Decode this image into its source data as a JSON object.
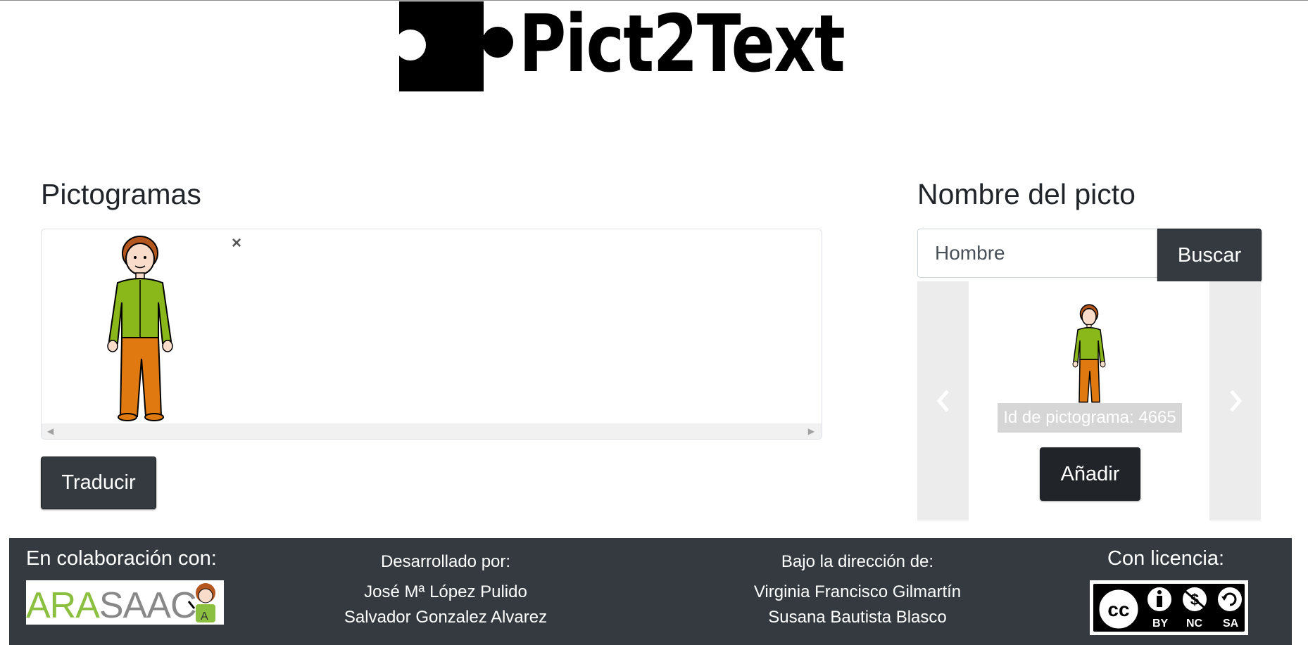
{
  "header": {
    "logo_text": "Pict2Text"
  },
  "pictos": {
    "title": "Pictogramas",
    "remove_label": "×",
    "translate_label": "Traducir"
  },
  "search": {
    "title": "Nombre del picto",
    "value": "Hombre",
    "button_label": "Buscar",
    "result_caption": "Id de pictograma: 4665",
    "add_label": "Añadir"
  },
  "footer": {
    "collab_title": "En colaboración con:",
    "collab_logo_text": "ARASAAC",
    "developed_title": "Desarrollado por:",
    "developers": [
      "José Mª López Pulido",
      "Salvador Gonzalez Alvarez"
    ],
    "direction_title": "Bajo la dirección de:",
    "directors": [
      "Virginia Francisco Gilmartín",
      "Susana Bautista Blasco"
    ],
    "license_title": "Con licencia:",
    "license_labels": [
      "BY",
      "NC",
      "SA"
    ]
  },
  "colors": {
    "dark": "#343a40",
    "button_dark": "#212529",
    "shirt": "#8ab81a",
    "pants": "#e07a10",
    "arasaac_green": "#8bbf3f",
    "arasaac_gray": "#888888"
  }
}
